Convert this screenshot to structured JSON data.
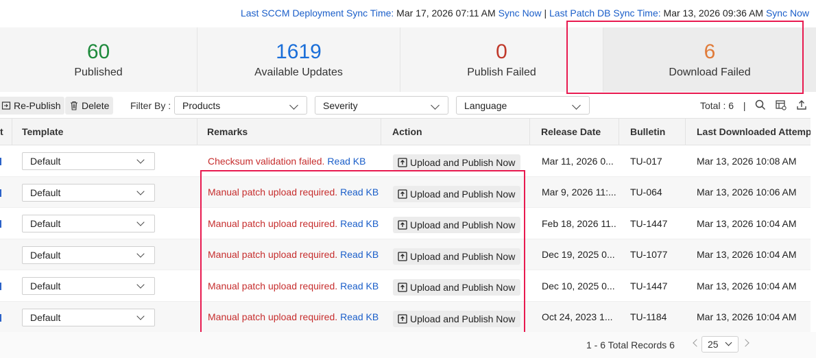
{
  "sync": {
    "sccm_label": "Last SCCM Deployment Sync Time:",
    "sccm_time": "Mar 17, 2026 07:11 AM",
    "sccm_link": "Sync Now",
    "separator": "|",
    "patchdb_label": "Last Patch DB Sync Time:",
    "patchdb_time": "Mar 13, 2026 09:36 AM",
    "patchdb_link": "Sync Now"
  },
  "stats": [
    {
      "value": "60",
      "label": "Published",
      "color": "#1e8a3c"
    },
    {
      "value": "1619",
      "label": "Available Updates",
      "color": "#1a6ed8"
    },
    {
      "value": "0",
      "label": "Publish Failed",
      "color": "#c0392b"
    },
    {
      "value": "6",
      "label": "Download Failed",
      "color": "#e07b39"
    }
  ],
  "toolbar": {
    "republish_label": "Re-Publish",
    "delete_label": "Delete",
    "filter_by_label": "Filter By :",
    "products_label": "Products",
    "severity_label": "Severity",
    "language_label": "Language",
    "total_label": "Total : 6",
    "divider": "|"
  },
  "table": {
    "columns": {
      "select": "t",
      "template": "Template",
      "remarks": "Remarks",
      "action": "Action",
      "release_date": "Release Date",
      "bulletin": "Bulletin",
      "last_download": "Last Downloaded Attempted"
    },
    "rows": [
      {
        "template": "Default",
        "remark": "Checksum validation failed.",
        "kb": "Read KB",
        "action": "Upload and Publish Now",
        "release_date": "Mar 11, 2026 0...",
        "bulletin": "TU-017",
        "last_download": "Mar 13, 2026 10:08 AM"
      },
      {
        "template": "Default",
        "remark": "Manual patch upload required.",
        "kb": "Read KB",
        "action": "Upload and Publish Now",
        "release_date": "Mar 9, 2026 11:...",
        "bulletin": "TU-064",
        "last_download": "Mar 13, 2026 10:06 AM"
      },
      {
        "template": "Default",
        "remark": "Manual patch upload required.",
        "kb": "Read KB",
        "action": "Upload and Publish Now",
        "release_date": "Feb 18, 2026 11...",
        "bulletin": "TU-1447",
        "last_download": "Mar 13, 2026 10:04 AM"
      },
      {
        "template": "Default",
        "remark": "Manual patch upload required.",
        "kb": "Read KB",
        "action": "Upload and Publish Now",
        "release_date": "Dec 19, 2025 0...",
        "bulletin": "TU-1077",
        "last_download": "Mar 13, 2026 10:04 AM"
      },
      {
        "template": "Default",
        "remark": "Manual patch upload required.",
        "kb": "Read KB",
        "action": "Upload and Publish Now",
        "release_date": "Dec 10, 2025 0...",
        "bulletin": "TU-1447",
        "last_download": "Mar 13, 2026 10:04 AM"
      },
      {
        "template": "Default",
        "remark": "Manual patch upload required.",
        "kb": "Read KB",
        "action": "Upload and Publish Now",
        "release_date": "Oct 24, 2023 1...",
        "bulletin": "TU-1184",
        "last_download": "Mar 13, 2026 10:04 AM"
      }
    ]
  },
  "footer": {
    "records": "1 - 6 Total Records 6",
    "page_size": "25"
  },
  "colors": {
    "highlight": "#e8194f",
    "link": "#1a5ec9",
    "error": "#c62d2d"
  }
}
